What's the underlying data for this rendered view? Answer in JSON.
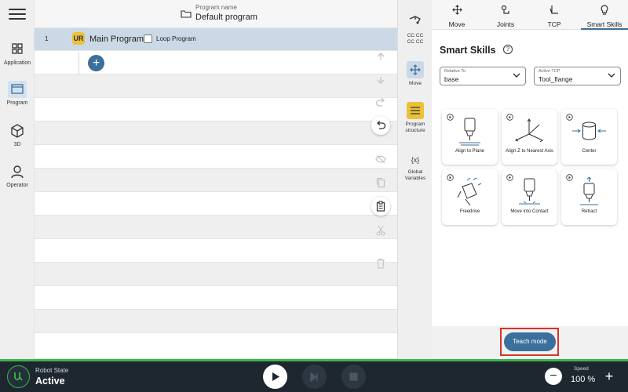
{
  "left_nav": {
    "items": [
      {
        "label": "Application",
        "icon": "grid-icon"
      },
      {
        "label": "Program",
        "icon": "program-icon"
      },
      {
        "label": "3D",
        "icon": "cube-icon"
      },
      {
        "label": "Operator",
        "icon": "person-icon"
      }
    ]
  },
  "header": {
    "caption": "Program name",
    "name": "Default program"
  },
  "tree": {
    "row_number": "1",
    "logo_text": "UR",
    "main_program": "Main Program",
    "loop_label": "Loop Program"
  },
  "middle": {
    "items": [
      {
        "label": "CC CC CC CC",
        "icon": "robot-arm-icon"
      },
      {
        "label": "Move",
        "icon": "move-icon"
      },
      {
        "label": "Program structure",
        "icon": "list-icon"
      },
      {
        "label": "Global Variables",
        "icon": "variables-icon"
      }
    ],
    "variables_glyph": "{x}"
  },
  "tabs": [
    {
      "label": "Move",
      "icon": "move-icon"
    },
    {
      "label": "Joints",
      "icon": "joints-icon"
    },
    {
      "label": "TCP",
      "icon": "tcp-icon"
    },
    {
      "label": "Smart Skills",
      "icon": "lightbulb-icon"
    }
  ],
  "panel": {
    "title": "Smart Skills",
    "help": "?",
    "relative_to": {
      "caption": "Relative To",
      "value": "base"
    },
    "active_tcp": {
      "caption": "Active TCP",
      "value": "Tool_flange"
    },
    "skills": [
      {
        "label": "Align to Plane"
      },
      {
        "label": "Align Z to Nearest Axis"
      },
      {
        "label": "Center"
      },
      {
        "label": "Freedrive"
      },
      {
        "label": "Move into Contact"
      },
      {
        "label": "Retract"
      }
    ],
    "teach_mode": "Teach mode"
  },
  "bottom": {
    "robot_state_caption": "Robot State",
    "robot_state": "Active",
    "speed_caption": "Speed",
    "speed_value": "100 %",
    "minus": "−",
    "plus": "+"
  },
  "colors": {
    "accent": "#3b6f9c",
    "active_row": "#cbd9e6",
    "logo": "#ecc13a",
    "bar": "#1e2730",
    "status_green": "#3cb54a",
    "highlight": "#d9342b"
  }
}
